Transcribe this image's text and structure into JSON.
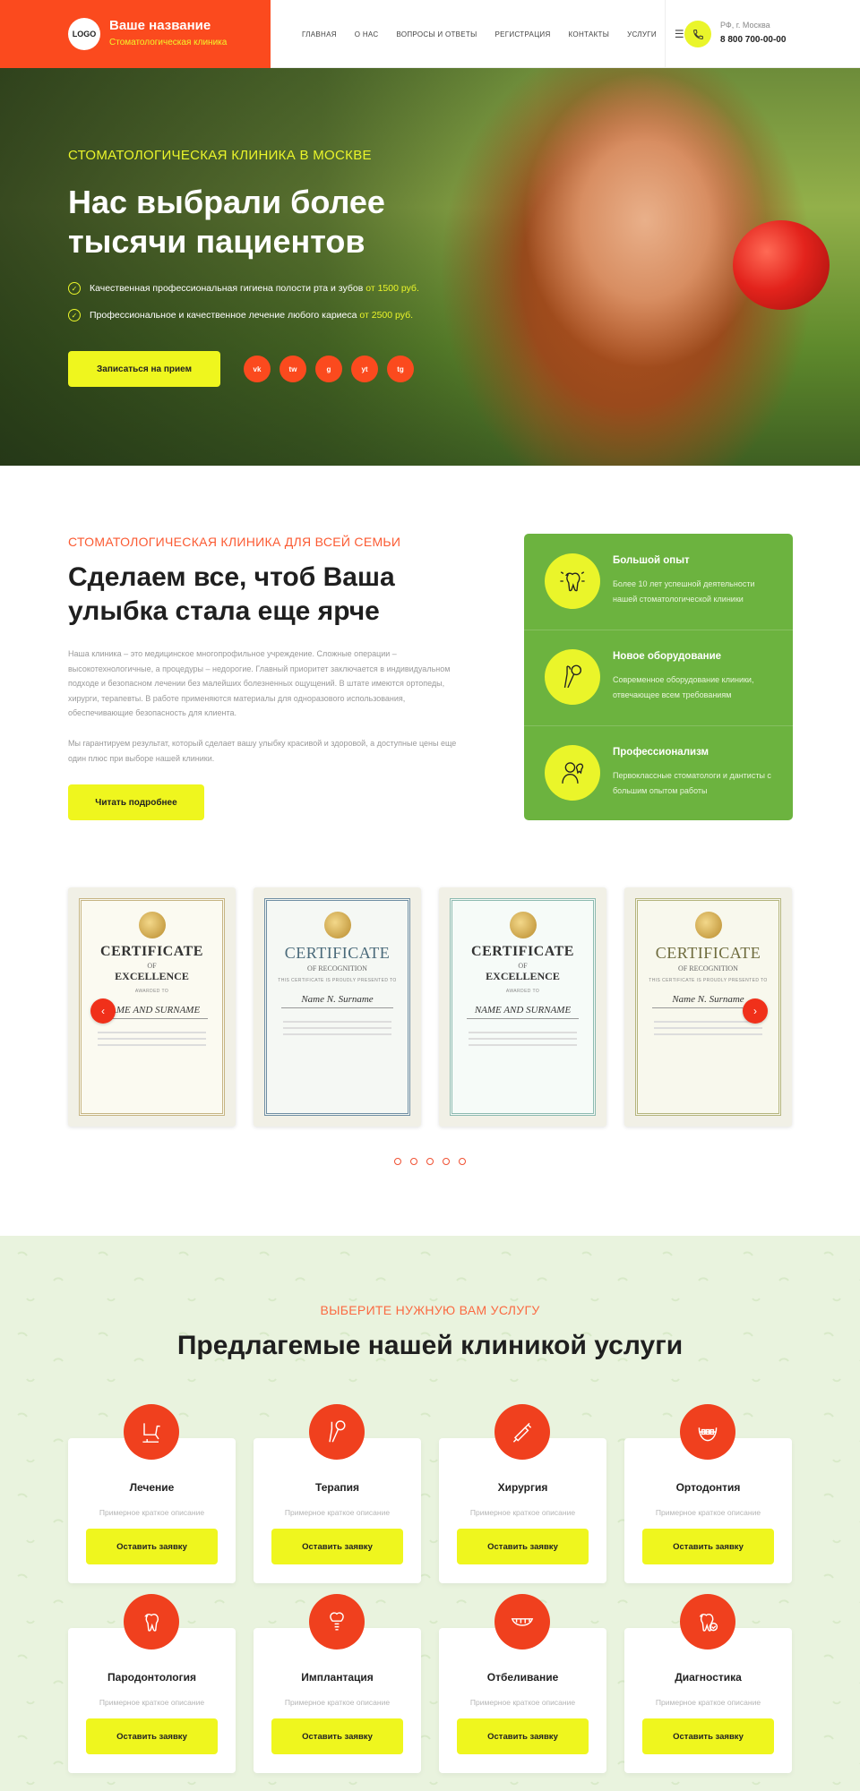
{
  "header": {
    "logo_text": "LOGO",
    "brand_name": "Ваше название",
    "brand_sub": "Стоматологическая клиника",
    "nav": [
      "ГЛАВНАЯ",
      "О НАС",
      "ВОПРОСЫ И ОТВЕТЫ",
      "РЕГИСТРАЦИЯ",
      "КОНТАКТЫ",
      "УСЛУГИ"
    ],
    "menu_icon": "hamburger-icon",
    "city": "РФ, г. Москва",
    "phone": "8 800 700-00-00"
  },
  "hero": {
    "eyebrow": "СТОМАТОЛОГИЧЕСКАЯ КЛИНИКА В МОСКВЕ",
    "title": "Нас выбрали более тысячи пациентов",
    "bullet1_text": "Качественная профессиональная гигиена полости рта и зубов",
    "bullet1_price": "от 1500 руб.",
    "bullet2_text": "Профессиональное и качественное лечение любого кариеса",
    "bullet2_price": "от 2500 руб.",
    "cta": "Записаться на прием",
    "socials": [
      "vk",
      "tw",
      "g",
      "yt",
      "tg"
    ]
  },
  "about": {
    "eyebrow": "СТОМАТОЛОГИЧЕСКАЯ КЛИНИКА ДЛЯ ВСЕЙ СЕМЬИ",
    "title": "Сделаем все, чтоб Ваша улыбка стала еще ярче",
    "p1": "Наша клиника – это медицинское многопрофильное учреждение. Сложные операции – высокотехнологичные, а процедуры – недорогие. Главный приоритет заключается в индивидуальном подходе и безопасном лечении без малейших болезненных ощущений. В штате имеются ортопеды, хирурги, терапевты. В работе применяются материалы для одноразового использования, обеспечивающие безопасность для клиента.",
    "p2": "Мы гарантируем результат, который сделает вашу улыбку красивой и здоровой, а доступные цены еще один плюс при выборе нашей клиники.",
    "cta": "Читать подробнее",
    "features": [
      {
        "title": "Большой опыт",
        "text": "Более 10 лет успешной деятельности нашей стоматологической клиники",
        "icon": "tooth-sparkle-icon"
      },
      {
        "title": "Новое оборудование",
        "text": "Современное оборудование клиники, отвечающее всем требованиям",
        "icon": "dental-tools-icon"
      },
      {
        "title": "Профессионализм",
        "text": "Первоклассные стоматологи и дантисты с большим опытом работы",
        "icon": "dentist-icon"
      }
    ]
  },
  "certificates": [
    {
      "t1": "CERTIFICATE",
      "t2": "OF",
      "t3": "EXCELLENCE",
      "small": "AWARDED TO",
      "name": "NAME AND SURNAME"
    },
    {
      "t1": "CERTIFICATE",
      "t2": "OF RECOGNITION",
      "t3": "",
      "small": "THIS CERTIFICATE IS PROUDLY PRESENTED TO",
      "name": "Name N. Surname"
    },
    {
      "t1": "CERTIFICATE",
      "t2": "OF",
      "t3": "EXCELLENCE",
      "small": "AWARDED TO",
      "name": "NAME AND SURNAME"
    },
    {
      "t1": "CERTIFICATE",
      "t2": "OF RECOGNITION",
      "t3": "",
      "small": "THIS CERTIFICATE IS PROUDLY PRESENTED TO",
      "name": "Name N. Surname"
    }
  ],
  "slider": {
    "prev": "‹",
    "next": "›",
    "dots": 5
  },
  "services": {
    "eyebrow": "ВЫБЕРИТЕ НУЖНУЮ ВАМ УСЛУГУ",
    "title": "Предлагемые нашей клиникой услуги",
    "desc": "Примерное краткое описание",
    "cta": "Оставить заявку",
    "items": [
      {
        "title": "Лечение",
        "icon": "dental-chair-icon"
      },
      {
        "title": "Терапия",
        "icon": "mirror-probe-icon"
      },
      {
        "title": "Хирургия",
        "icon": "drill-icon"
      },
      {
        "title": "Ортодонтия",
        "icon": "braces-icon"
      },
      {
        "title": "Пародонтология",
        "icon": "tooth-gum-icon"
      },
      {
        "title": "Имплантация",
        "icon": "implant-icon"
      },
      {
        "title": "Отбеливание",
        "icon": "smile-teeth-icon"
      },
      {
        "title": "Диагностика",
        "icon": "tooth-check-icon"
      }
    ]
  },
  "colors": {
    "accent": "#fb4a1e",
    "yellow": "#eff61e",
    "green": "#6cb33f"
  }
}
